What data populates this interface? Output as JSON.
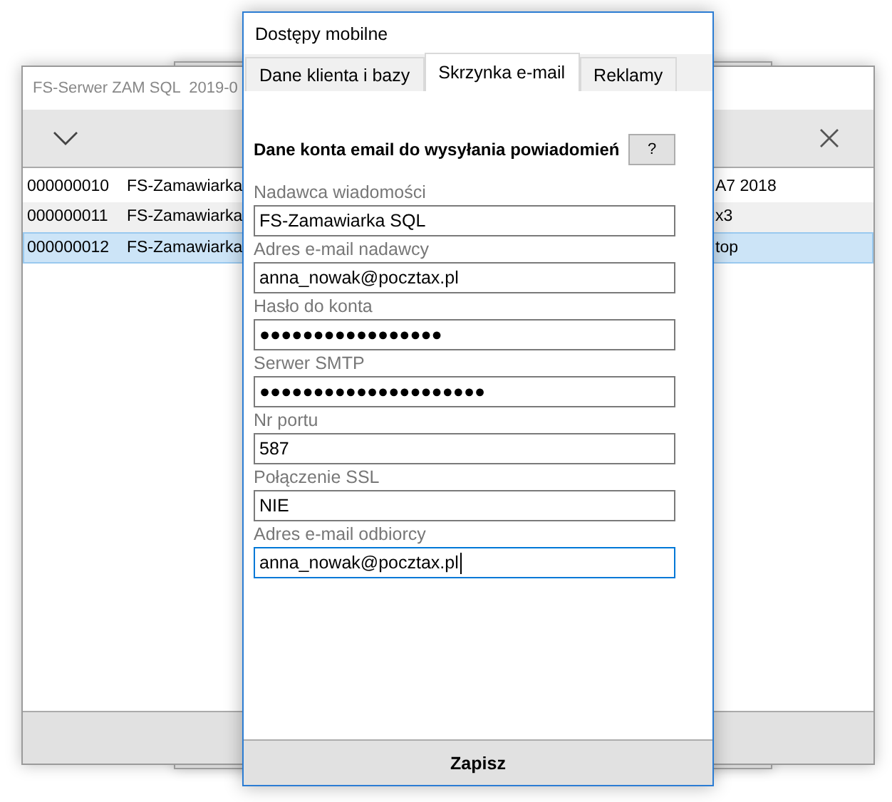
{
  "background_window": {
    "title": "FS-Serwer ZAM SQL  2019-0",
    "rows": [
      {
        "column_1": "000000010",
        "column_2": "FS-Zamawiarka",
        "column_3": "A7 2018",
        "selected": false
      },
      {
        "column_1": "000000011",
        "column_2": "FS-Zamawiarka",
        "column_3": "x3",
        "selected": false
      },
      {
        "column_1": "000000012",
        "column_2": "FS-Zamawiarka",
        "column_3": "top",
        "selected": true
      }
    ]
  },
  "dialog": {
    "title": "Dostępy mobilne",
    "tabs": [
      {
        "label": "Dane klienta i bazy",
        "selected": false
      },
      {
        "label": "Skrzynka e-mail",
        "selected": true
      },
      {
        "label": "Reklamy",
        "selected": false
      }
    ],
    "heading": "Dane konta email do wysyłania powiadomień",
    "help_button": "?",
    "fields": [
      {
        "label": "Nadawca wiadomości",
        "value": "FS-Zamawiarka SQL",
        "focused": false
      },
      {
        "label": "Adres e-mail nadawcy",
        "value": "anna_nowak@pocztax.pl",
        "focused": false
      },
      {
        "label": "Hasło do konta",
        "value": "●●●●●●●●●●●●●●●●●",
        "focused": false
      },
      {
        "label": "Serwer SMTP",
        "value": "●●●●●●●●●●●●●●●●●●●●●",
        "focused": false
      },
      {
        "label": "Nr portu",
        "value": "587",
        "focused": false
      },
      {
        "label": "Połączenie SSL",
        "value": "NIE",
        "focused": false
      },
      {
        "label": "Adres e-mail odbiorcy",
        "value": "anna_nowak@pocztax.pl",
        "focused": true
      }
    ],
    "save_button": "Zapisz"
  }
}
